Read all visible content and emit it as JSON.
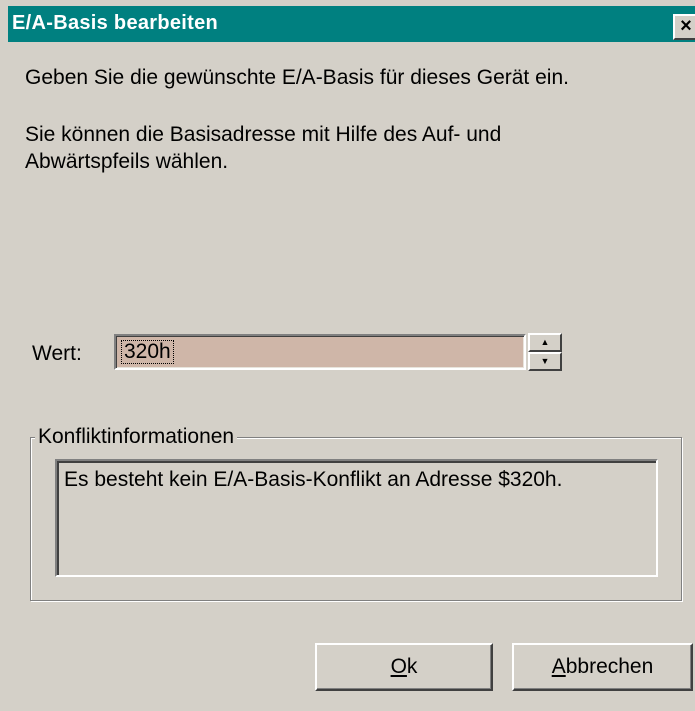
{
  "window": {
    "title": "E/A-Basis bearbeiten",
    "close_glyph": "×"
  },
  "instructions": {
    "line1": "Geben Sie die gewünschte E/A-Basis für dieses Gerät ein.",
    "line2a": "Sie können die Basisadresse mit Hilfe des Auf- und",
    "line2b": "Abwärtspfeils wählen."
  },
  "value_field": {
    "label": "Wert:",
    "value": "320h",
    "spin_up_glyph": "▲",
    "spin_down_glyph": "▼"
  },
  "conflict_group": {
    "label": "Konfliktinformationen",
    "message": "Es besteht kein E/A-Basis-Konflikt an Adresse $320h."
  },
  "buttons": {
    "ok": {
      "mnemonic": "O",
      "rest": "k"
    },
    "cancel": {
      "mnemonic": "A",
      "rest": "bbrechen"
    }
  }
}
